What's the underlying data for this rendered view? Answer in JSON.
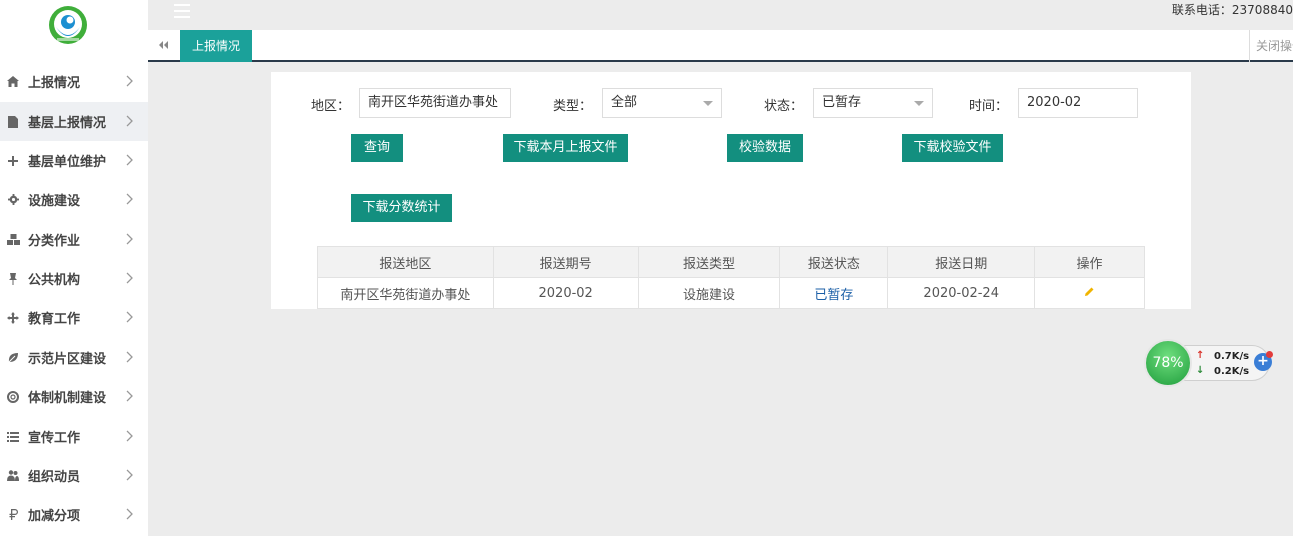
{
  "sidebar": {
    "items": [
      {
        "label": "上报情况",
        "icon": "home-icon"
      },
      {
        "label": "基层上报情况",
        "icon": "document-icon"
      },
      {
        "label": "基层单位维护",
        "icon": "plus-icon"
      },
      {
        "label": "设施建设",
        "icon": "gear-icon"
      },
      {
        "label": "分类作业",
        "icon": "cubes-icon"
      },
      {
        "label": "公共机构",
        "icon": "pin-icon"
      },
      {
        "label": "教育工作",
        "icon": "arrows-icon"
      },
      {
        "label": "示范片区建设",
        "icon": "leaf-icon"
      },
      {
        "label": "体制机制建设",
        "icon": "lifebuoy-icon"
      },
      {
        "label": "宣传工作",
        "icon": "list-icon"
      },
      {
        "label": "组织动员",
        "icon": "people-icon"
      },
      {
        "label": "加减分项",
        "icon": "ruble-icon"
      }
    ]
  },
  "topbar": {
    "contact": "联系电话：23708840"
  },
  "tabs": {
    "active": "上报情况",
    "close_ops": "关闭操作"
  },
  "filters": {
    "region_label": "地区：",
    "region_value": "南开区华苑街道办事处",
    "type_label": "类型：",
    "type_value": "全部",
    "status_label": "状态：",
    "status_value": "已暂存",
    "time_label": "时间：",
    "time_value": "2020-02"
  },
  "buttons": {
    "query": "查询",
    "download_month": "下载本月上报文件",
    "verify": "校验数据",
    "download_verify": "下载校验文件",
    "download_score": "下载分数统计"
  },
  "table": {
    "headers": [
      "报送地区",
      "报送期号",
      "报送类型",
      "报送状态",
      "报送日期",
      "操作"
    ],
    "rows": [
      [
        "南开区华苑街道办事处",
        "2020-02",
        "设施建设",
        "已暂存",
        "2020-02-24"
      ]
    ]
  },
  "speed": {
    "percent": "78%",
    "up": "0.7K/s",
    "down": "0.2K/s"
  },
  "colors": {
    "accent": "#1ba19a",
    "button": "#138f7f",
    "status_link": "#1b5fa7"
  }
}
